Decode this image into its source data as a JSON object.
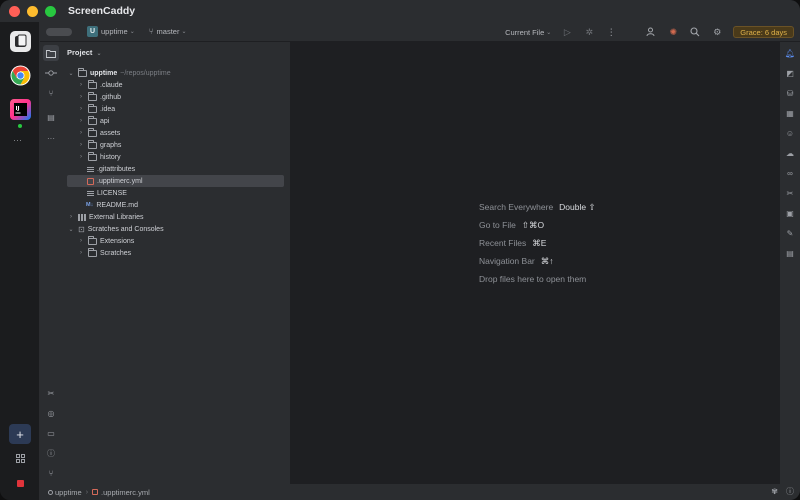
{
  "app": {
    "title": "ScreenCaddy"
  },
  "toolbar": {
    "project_badge": "U",
    "project_name": "upptime",
    "branch": "master",
    "run_config": "Current File",
    "grace_badge": "Grace: 6 days"
  },
  "project_panel": {
    "title": "Project",
    "tree": [
      {
        "label": "upptime",
        "hint": "~/repos/upptime",
        "type": "root"
      },
      {
        "label": ".claude",
        "type": "folder"
      },
      {
        "label": ".github",
        "type": "folder"
      },
      {
        "label": ".idea",
        "type": "folder"
      },
      {
        "label": "api",
        "type": "folder"
      },
      {
        "label": "assets",
        "type": "folder"
      },
      {
        "label": "graphs",
        "type": "folder"
      },
      {
        "label": "history",
        "type": "folder"
      },
      {
        "label": ".gitattributes",
        "type": "file"
      },
      {
        "label": ".upptimerc.yml",
        "type": "yml"
      },
      {
        "label": "LICENSE",
        "type": "file"
      },
      {
        "label": "README.md",
        "type": "md"
      },
      {
        "label": "External Libraries",
        "type": "library"
      },
      {
        "label": "Scratches and Consoles",
        "type": "scratches"
      },
      {
        "label": "Extensions",
        "type": "folder"
      },
      {
        "label": "Scratches",
        "type": "folder"
      }
    ]
  },
  "editor": {
    "hints": [
      {
        "label": "Search Everywhere",
        "key": "Double ⇧"
      },
      {
        "label": "Go to File",
        "key": "⇧⌘O"
      },
      {
        "label": "Recent Files",
        "key": "⌘E"
      },
      {
        "label": "Navigation Bar",
        "key": "⌘↑"
      },
      {
        "label": "Drop files here to open them",
        "key": ""
      }
    ]
  },
  "statusbar": {
    "project": "upptime",
    "file": ".upptimerc.yml"
  },
  "colors": {
    "accent_grace": "#e0b24a",
    "selected_row": "#43454a",
    "traffic_red": "#ff5f57",
    "traffic_yellow": "#febc2e",
    "traffic_green": "#28c840"
  },
  "icons": {
    "dock": [
      "screencaddy-app-icon",
      "chrome-icon",
      "intellij-icon"
    ],
    "toolbar_right": [
      "run-icon",
      "debug-icon",
      "more-icon",
      "add-user-icon",
      "ai-assistant-icon",
      "search-icon",
      "settings-icon"
    ]
  }
}
